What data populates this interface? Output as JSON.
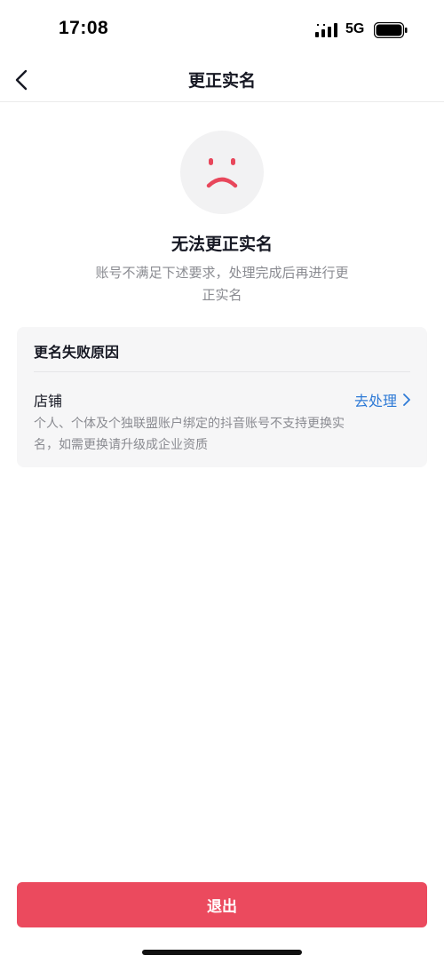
{
  "status_bar": {
    "time": "17:08",
    "network": "5G",
    "icons": [
      "signal-icon",
      "battery-icon"
    ]
  },
  "nav": {
    "title": "更正实名",
    "back_icon": "chevron-left-icon"
  },
  "result": {
    "icon": "sad-face-icon",
    "icon_color": "#e8475b",
    "title": "无法更正实名",
    "description": "账号不满足下述要求，处理完成后再进行更正实名"
  },
  "failure_card": {
    "header": "更名失败原因",
    "items": [
      {
        "title": "店铺",
        "action_label": "去处理",
        "action_icon": "chevron-right-icon",
        "description": "个人、个体及个独联盟账户绑定的抖音账号不支持更换实名，如需更换请升级成企业资质"
      }
    ]
  },
  "footer": {
    "exit_label": "退出"
  },
  "colors": {
    "accent": "#eb4a5e",
    "link": "#2e7ad6",
    "muted_text": "#8a8b91",
    "card_bg": "#f6f6f7"
  }
}
